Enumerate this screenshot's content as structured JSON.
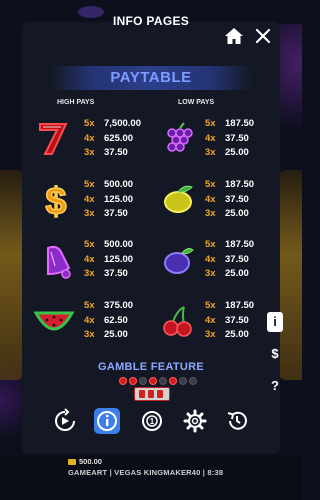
{
  "header": {
    "title": "INFO PAGES"
  },
  "paytable": {
    "title": "PAYTABLE",
    "high_pays_label": "HIGH PAYS",
    "low_pays_label": "LOW PAYS",
    "high": [
      {
        "symbol": "seven",
        "pays": [
          {
            "mult": "5x",
            "val": "7,500.00"
          },
          {
            "mult": "4x",
            "val": "625.00"
          },
          {
            "mult": "3x",
            "val": "37.50"
          }
        ]
      },
      {
        "symbol": "dollar",
        "pays": [
          {
            "mult": "5x",
            "val": "500.00"
          },
          {
            "mult": "4x",
            "val": "125.00"
          },
          {
            "mult": "3x",
            "val": "37.50"
          }
        ]
      },
      {
        "symbol": "bell",
        "pays": [
          {
            "mult": "5x",
            "val": "500.00"
          },
          {
            "mult": "4x",
            "val": "125.00"
          },
          {
            "mult": "3x",
            "val": "37.50"
          }
        ]
      },
      {
        "symbol": "watermelon",
        "pays": [
          {
            "mult": "5x",
            "val": "375.00"
          },
          {
            "mult": "4x",
            "val": "62.50"
          },
          {
            "mult": "3x",
            "val": "25.00"
          }
        ]
      }
    ],
    "low": [
      {
        "symbol": "grapes",
        "pays": [
          {
            "mult": "5x",
            "val": "187.50"
          },
          {
            "mult": "4x",
            "val": "37.50"
          },
          {
            "mult": "3x",
            "val": "25.00"
          }
        ]
      },
      {
        "symbol": "lemon",
        "pays": [
          {
            "mult": "5x",
            "val": "187.50"
          },
          {
            "mult": "4x",
            "val": "37.50"
          },
          {
            "mult": "3x",
            "val": "25.00"
          }
        ]
      },
      {
        "symbol": "plum",
        "pays": [
          {
            "mult": "5x",
            "val": "187.50"
          },
          {
            "mult": "4x",
            "val": "37.50"
          },
          {
            "mult": "3x",
            "val": "25.00"
          }
        ]
      },
      {
        "symbol": "cherries",
        "pays": [
          {
            "mult": "5x",
            "val": "187.50"
          },
          {
            "mult": "4x",
            "val": "37.50"
          },
          {
            "mult": "3x",
            "val": "25.00"
          }
        ]
      }
    ]
  },
  "gamble": {
    "title": "GAMBLE FEATURE"
  },
  "side_buttons": {
    "info": "i",
    "dollar": "$",
    "help": "?"
  },
  "toolbar": {
    "active": "info-icon"
  },
  "footer": {
    "balance": "500.00",
    "text": "GAMEART | VEGAS KINGMAKER40 | 8:38"
  },
  "colors": {
    "accent_orange": "#f2a623",
    "title_blue": "#7d9cff",
    "active_blue": "#3d7ee8"
  }
}
